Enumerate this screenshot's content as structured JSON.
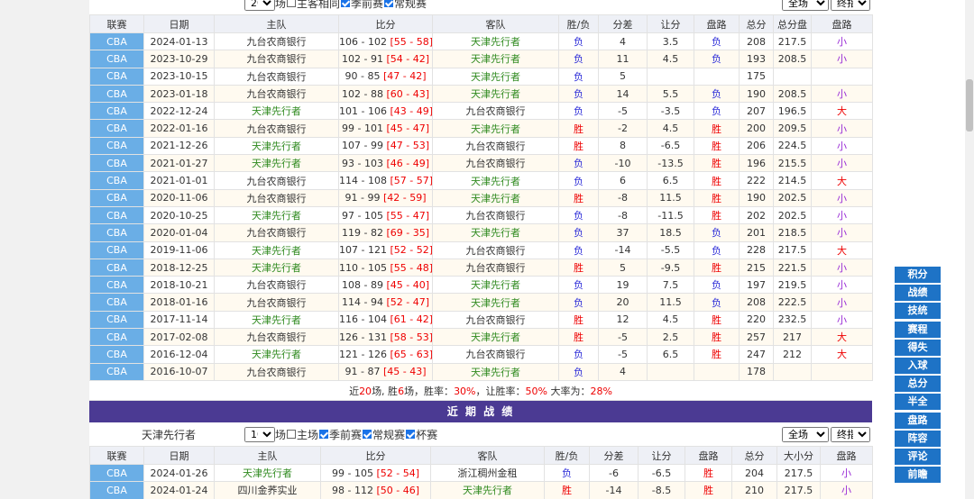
{
  "h2h": {
    "count_options": [
      "20"
    ],
    "count_selected": "20",
    "count_suffix": "场",
    "filters": [
      {
        "label": "主客相同",
        "checked": false
      },
      {
        "label": "季前赛",
        "checked": true
      },
      {
        "label": "常规赛",
        "checked": true
      }
    ],
    "scope_select": "全场",
    "switch_select": "终指",
    "headers": [
      "联赛",
      "日期",
      "主队",
      "比分",
      "客队",
      "胜/负",
      "分差",
      "让分",
      "盘路",
      "总分",
      "总分盘",
      "盘路"
    ],
    "rows": [
      [
        "CBA",
        "2024-01-13",
        "九台农商银行",
        "106 - 102",
        "[55 - 58]",
        "天津先行者",
        "负",
        "4",
        "3.5",
        "负",
        "208",
        "217.5",
        "小"
      ],
      [
        "CBA",
        "2023-10-29",
        "九台农商银行",
        "102 - 91",
        "[54 - 42]",
        "天津先行者",
        "负",
        "11",
        "4.5",
        "负",
        "193",
        "208.5",
        "小"
      ],
      [
        "CBA",
        "2023-10-15",
        "九台农商银行",
        "90 - 85",
        "[47 - 42]",
        "天津先行者",
        "负",
        "5",
        "",
        "",
        "175",
        "",
        ""
      ],
      [
        "CBA",
        "2023-01-18",
        "九台农商银行",
        "102 - 88",
        "[60 - 43]",
        "天津先行者",
        "负",
        "14",
        "5.5",
        "负",
        "190",
        "208.5",
        "小"
      ],
      [
        "CBA",
        "2022-12-24",
        "天津先行者",
        "101 - 106",
        "[43 - 49]",
        "九台农商银行",
        "负",
        "-5",
        "-3.5",
        "负",
        "207",
        "196.5",
        "大"
      ],
      [
        "CBA",
        "2022-01-16",
        "九台农商银行",
        "99 - 101",
        "[45 - 47]",
        "天津先行者",
        "胜",
        "-2",
        "4.5",
        "胜",
        "200",
        "209.5",
        "小"
      ],
      [
        "CBA",
        "2021-12-26",
        "天津先行者",
        "107 - 99",
        "[47 - 53]",
        "九台农商银行",
        "胜",
        "8",
        "-6.5",
        "胜",
        "206",
        "224.5",
        "小"
      ],
      [
        "CBA",
        "2021-01-27",
        "天津先行者",
        "93 - 103",
        "[46 - 49]",
        "九台农商银行",
        "负",
        "-10",
        "-13.5",
        "胜",
        "196",
        "215.5",
        "小"
      ],
      [
        "CBA",
        "2021-01-01",
        "九台农商银行",
        "114 - 108",
        "[57 - 57]",
        "天津先行者",
        "负",
        "6",
        "6.5",
        "胜",
        "222",
        "214.5",
        "大"
      ],
      [
        "CBA",
        "2020-11-06",
        "九台农商银行",
        "91 - 99",
        "[42 - 59]",
        "天津先行者",
        "胜",
        "-8",
        "11.5",
        "胜",
        "190",
        "202.5",
        "小"
      ],
      [
        "CBA",
        "2020-10-25",
        "天津先行者",
        "97 - 105",
        "[55 - 47]",
        "九台农商银行",
        "负",
        "-8",
        "-11.5",
        "胜",
        "202",
        "202.5",
        "小"
      ],
      [
        "CBA",
        "2020-01-04",
        "九台农商银行",
        "119 - 82",
        "[69 - 35]",
        "天津先行者",
        "负",
        "37",
        "18.5",
        "负",
        "201",
        "218.5",
        "小"
      ],
      [
        "CBA",
        "2019-11-06",
        "天津先行者",
        "107 - 121",
        "[52 - 52]",
        "九台农商银行",
        "负",
        "-14",
        "-5.5",
        "负",
        "228",
        "217.5",
        "大"
      ],
      [
        "CBA",
        "2018-12-25",
        "天津先行者",
        "110 - 105",
        "[55 - 48]",
        "九台农商银行",
        "胜",
        "5",
        "-9.5",
        "胜",
        "215",
        "221.5",
        "小"
      ],
      [
        "CBA",
        "2018-10-21",
        "九台农商银行",
        "108 - 89",
        "[45 - 40]",
        "天津先行者",
        "负",
        "19",
        "7.5",
        "负",
        "197",
        "219.5",
        "小"
      ],
      [
        "CBA",
        "2018-01-16",
        "九台农商银行",
        "114 - 94",
        "[52 - 47]",
        "天津先行者",
        "负",
        "20",
        "11.5",
        "负",
        "208",
        "222.5",
        "小"
      ],
      [
        "CBA",
        "2017-11-14",
        "天津先行者",
        "116 - 104",
        "[61 - 42]",
        "九台农商银行",
        "胜",
        "12",
        "4.5",
        "胜",
        "220",
        "232.5",
        "小"
      ],
      [
        "CBA",
        "2017-02-08",
        "九台农商银行",
        "126 - 131",
        "[58 - 53]",
        "天津先行者",
        "胜",
        "-5",
        "2.5",
        "胜",
        "257",
        "217",
        "大"
      ],
      [
        "CBA",
        "2016-12-04",
        "天津先行者",
        "121 - 126",
        "[65 - 63]",
        "九台农商银行",
        "负",
        "-5",
        "6.5",
        "胜",
        "247",
        "212",
        "大"
      ],
      [
        "CBA",
        "2016-10-07",
        "九台农商银行",
        "91 - 87",
        "[45 - 43]",
        "天津先行者",
        "负",
        "4",
        "",
        "",
        "178",
        "",
        ""
      ]
    ],
    "summary": {
      "p1": "近",
      "games": "20",
      "p2": "场, 胜",
      "wins": "6",
      "p3": "场，胜率：",
      "winrate": "30%",
      "p4": "，让胜率：",
      "atsrate": "50%",
      "p5": " 大率为：",
      "overrate": "28%"
    }
  },
  "recent": {
    "band_title": "近 期 战 绩",
    "team_name": "天津先行者",
    "count_selected": "10",
    "count_suffix": "场",
    "filters": [
      {
        "label": "主场",
        "checked": false
      },
      {
        "label": "季前赛",
        "checked": true
      },
      {
        "label": "常规赛",
        "checked": true
      },
      {
        "label": "杯赛",
        "checked": true
      }
    ],
    "scope_select": "全场",
    "switch_select": "终指",
    "headers": [
      "联赛",
      "日期",
      "主队",
      "比分",
      "客队",
      "胜/负",
      "分差",
      "让分",
      "盘路",
      "总分",
      "大小分",
      "盘路"
    ],
    "rows": [
      [
        "CBA",
        "2024-01-26",
        "天津先行者",
        "99 - 105",
        "[52 - 54]",
        "浙江稠州金租",
        "负",
        "-6",
        "-6.5",
        "胜",
        "204",
        "217.5",
        "小"
      ],
      [
        "CBA",
        "2024-01-24",
        "四川金荞实业",
        "98 - 112",
        "[50 - 46]",
        "天津先行者",
        "胜",
        "-14",
        "-8.5",
        "胜",
        "210",
        "217.5",
        "小"
      ]
    ]
  },
  "sidebar": [
    "积分",
    "战绩",
    "技统",
    "赛程",
    "得失",
    "入球",
    "总分",
    "半全",
    "盘路",
    "阵容",
    "评论",
    "前瞻"
  ],
  "back_to_top": "arrow-up-icon"
}
